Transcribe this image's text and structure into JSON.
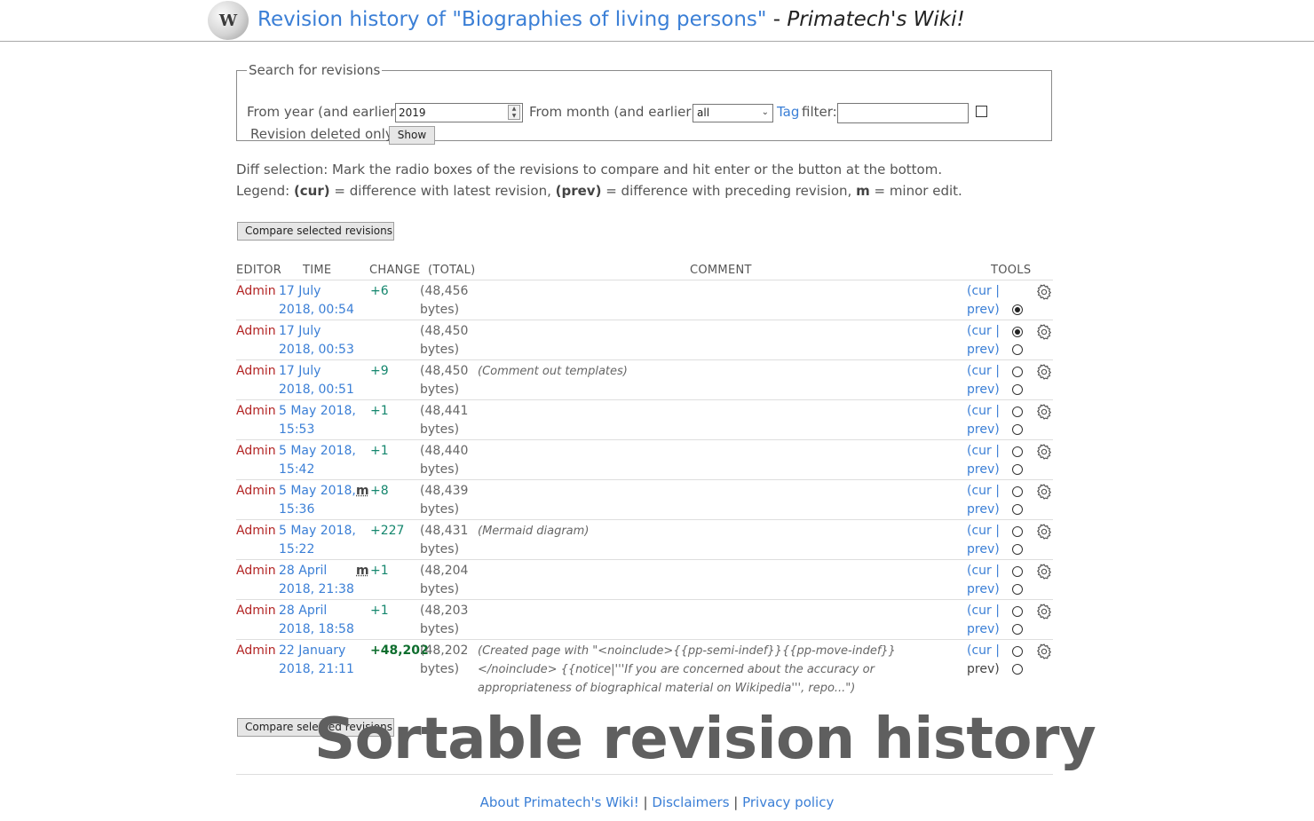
{
  "header": {
    "title_link": "Revision history of \"Biographies of living persons\"",
    "separator": " - ",
    "site_name": "Primatech's Wiki!",
    "logo_glyph": "W"
  },
  "search": {
    "legend": "Search for revisions",
    "year_label": "From year (and earlier):",
    "year_value": "2019",
    "month_label": "From month (and earlier):",
    "month_value": "all",
    "tag_link": "Tag",
    "filter_label": "filter:",
    "tag_value": "",
    "deleted_label": "Revision deleted only",
    "show_button": "Show"
  },
  "help": {
    "diff_text": "Diff selection: Mark the radio boxes of the revisions to compare and hit enter or the button at the bottom.",
    "legend_prefix": "Legend:",
    "legend_cur": "(cur)",
    "legend_cur_text": " = difference with latest revision, ",
    "legend_prev": "(prev)",
    "legend_prev_text": " = difference with preceding revision, ",
    "legend_m": "m",
    "legend_m_text": " = minor edit."
  },
  "compare_button": "Compare selected revisions",
  "table": {
    "headers": {
      "editor": "EDITOR",
      "time": "TIME",
      "change": "CHANGE",
      "total": "(TOTAL)",
      "comment": "COMMENT",
      "tools": "TOOLS"
    },
    "rows": [
      {
        "editor": "Admin",
        "time": "17 July 2018, 00:54",
        "minor": "",
        "change": "+6",
        "total": "(48,456 bytes)",
        "comment": "",
        "cur": "(cur |",
        "prev": "prev)",
        "radio_old": "",
        "radio_new": "checked"
      },
      {
        "editor": "Admin",
        "time": "17 July 2018, 00:53",
        "minor": "",
        "change": "",
        "total": "(48,450 bytes)",
        "comment": "",
        "cur": "(cur |",
        "prev": "prev)",
        "radio_old": "checked",
        "radio_new": ""
      },
      {
        "editor": "Admin",
        "time": "17 July 2018, 00:51",
        "minor": "",
        "change": "+9",
        "total": "(48,450 bytes)",
        "comment": "(Comment out templates)",
        "cur": "(cur |",
        "prev": "prev)",
        "radio_old": "",
        "radio_new": ""
      },
      {
        "editor": "Admin",
        "time": "5 May 2018, 15:53",
        "minor": "",
        "change": "+1",
        "total": "(48,441 bytes)",
        "comment": "",
        "cur": "(cur |",
        "prev": "prev)",
        "radio_old": "",
        "radio_new": ""
      },
      {
        "editor": "Admin",
        "time": "5 May 2018, 15:42",
        "minor": "",
        "change": "+1",
        "total": "(48,440 bytes)",
        "comment": "",
        "cur": "(cur |",
        "prev": "prev)",
        "radio_old": "",
        "radio_new": ""
      },
      {
        "editor": "Admin",
        "time": "5 May 2018, 15:36",
        "minor": "m",
        "change": "+8",
        "total": "(48,439 bytes)",
        "comment": "",
        "cur": "(cur |",
        "prev": "prev)",
        "radio_old": "",
        "radio_new": ""
      },
      {
        "editor": "Admin",
        "time": "5 May 2018, 15:22",
        "minor": "",
        "change": "+227",
        "total": "(48,431 bytes)",
        "comment": "(Mermaid diagram)",
        "cur": "(cur |",
        "prev": "prev)",
        "radio_old": "",
        "radio_new": ""
      },
      {
        "editor": "Admin",
        "time": "28 April 2018, 21:38",
        "minor": "m",
        "change": "+1",
        "total": "(48,204 bytes)",
        "comment": "",
        "cur": "(cur |",
        "prev": "prev)",
        "radio_old": "",
        "radio_new": ""
      },
      {
        "editor": "Admin",
        "time": "28 April 2018, 18:58",
        "minor": "",
        "change": "+1",
        "total": "(48,203 bytes)",
        "comment": "",
        "cur": "(cur |",
        "prev": "prev)",
        "radio_old": "",
        "radio_new": ""
      },
      {
        "editor": "Admin",
        "time": "22 January 2018, 21:11",
        "minor": "",
        "change": "+48,202",
        "total": "(48,202 bytes)",
        "comment": "(Created page with \"<noinclude>{{pp-semi-indef}}{{pp-move-indef}}</noinclude> {{notice|'''If you are concerned about the accuracy or appropriateness of biographical material on Wikipedia''', repo...\")",
        "cur": "(cur |",
        "prev": "prev)",
        "radio_old": "",
        "radio_new": ""
      }
    ]
  },
  "overlay_title": "Sortable revision history",
  "footer": {
    "about": "About Primatech's Wiki!",
    "sep": " | ",
    "disclaimers": "Disclaimers",
    "privacy": "Privacy policy"
  },
  "icons": {
    "gear": "gear-icon",
    "logo": "wiki-globe-logo"
  },
  "colors": {
    "link": "#3b7fd6",
    "editor": "#b32424",
    "positive_change": "#14866d"
  }
}
